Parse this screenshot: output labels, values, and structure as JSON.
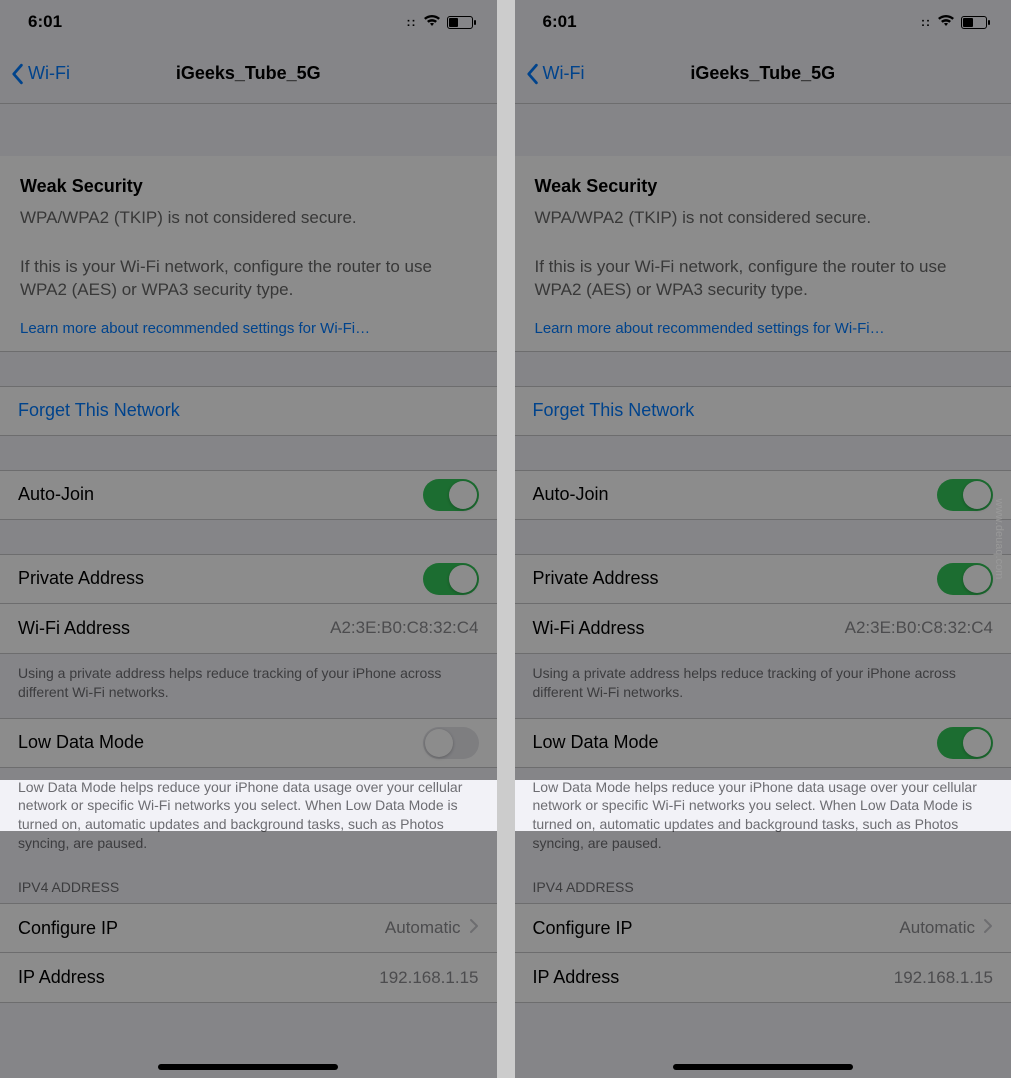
{
  "status": {
    "time": "6:01"
  },
  "nav": {
    "back": "Wi-Fi",
    "title": "iGeeks_Tube_5G"
  },
  "security": {
    "heading": "Weak Security",
    "msg1": "WPA/WPA2 (TKIP) is not considered secure.",
    "msg2": "If this is your Wi-Fi network, configure the router to use WPA2 (AES) or WPA3 security type.",
    "learn": "Learn more about recommended settings for Wi-Fi…"
  },
  "rows": {
    "forget": "Forget This Network",
    "autojoin": "Auto-Join",
    "private": "Private Address",
    "wifi_addr_label": "Wi-Fi Address",
    "wifi_addr_value": "A2:3E:B0:C8:32:C4",
    "private_footer": "Using a private address helps reduce tracking of your iPhone across different Wi-Fi networks.",
    "lowdata": "Low Data Mode",
    "lowdata_footer": "Low Data Mode helps reduce your iPhone data usage over your cellular network or specific Wi-Fi networks you select. When Low Data Mode is turned on, automatic updates and background tasks, such as Photos syncing, are paused.",
    "ipv4_label": "IPV4 ADDRESS",
    "configure_ip": "Configure IP",
    "configure_ip_value": "Automatic",
    "ip_addr_label": "IP Address",
    "ip_addr_value": "192.168.1.15"
  },
  "watermark": "www.deuaq.com"
}
